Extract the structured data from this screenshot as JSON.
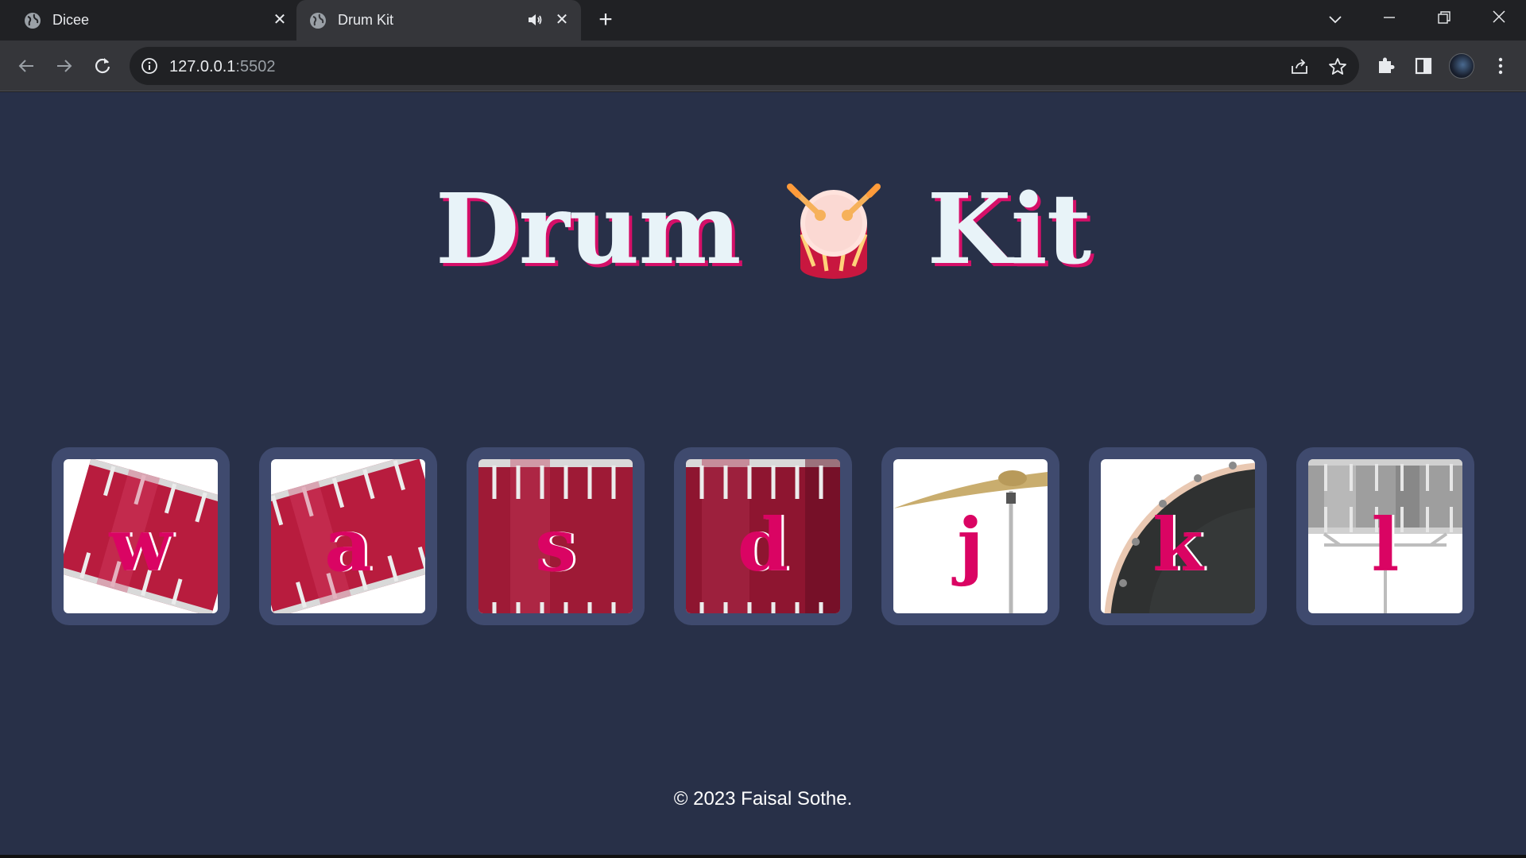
{
  "browser": {
    "tabs": [
      {
        "title": "Dicee",
        "active": false
      },
      {
        "title": "Drum Kit",
        "active": true,
        "playing_audio": true
      }
    ],
    "address": {
      "host": "127.0.0.1",
      "port": ":5502"
    }
  },
  "page": {
    "heading": {
      "left_word": "Drum",
      "right_word": "Kit",
      "emoji": "drum-emoji-icon"
    },
    "drums": [
      {
        "key": "w",
        "image": "tom-1"
      },
      {
        "key": "a",
        "image": "tom-2"
      },
      {
        "key": "s",
        "image": "tom-3"
      },
      {
        "key": "d",
        "image": "tom-4"
      },
      {
        "key": "j",
        "image": "crash-cymbal"
      },
      {
        "key": "k",
        "image": "kick-drum"
      },
      {
        "key": "l",
        "image": "snare-drum"
      }
    ],
    "footer": "© 2023 Faisal Sothe."
  },
  "colors": {
    "page_bg": "#283048",
    "drum_frame": "#3f4a6e",
    "accent": "#da0463",
    "heading_text": "#e8f3f8"
  }
}
